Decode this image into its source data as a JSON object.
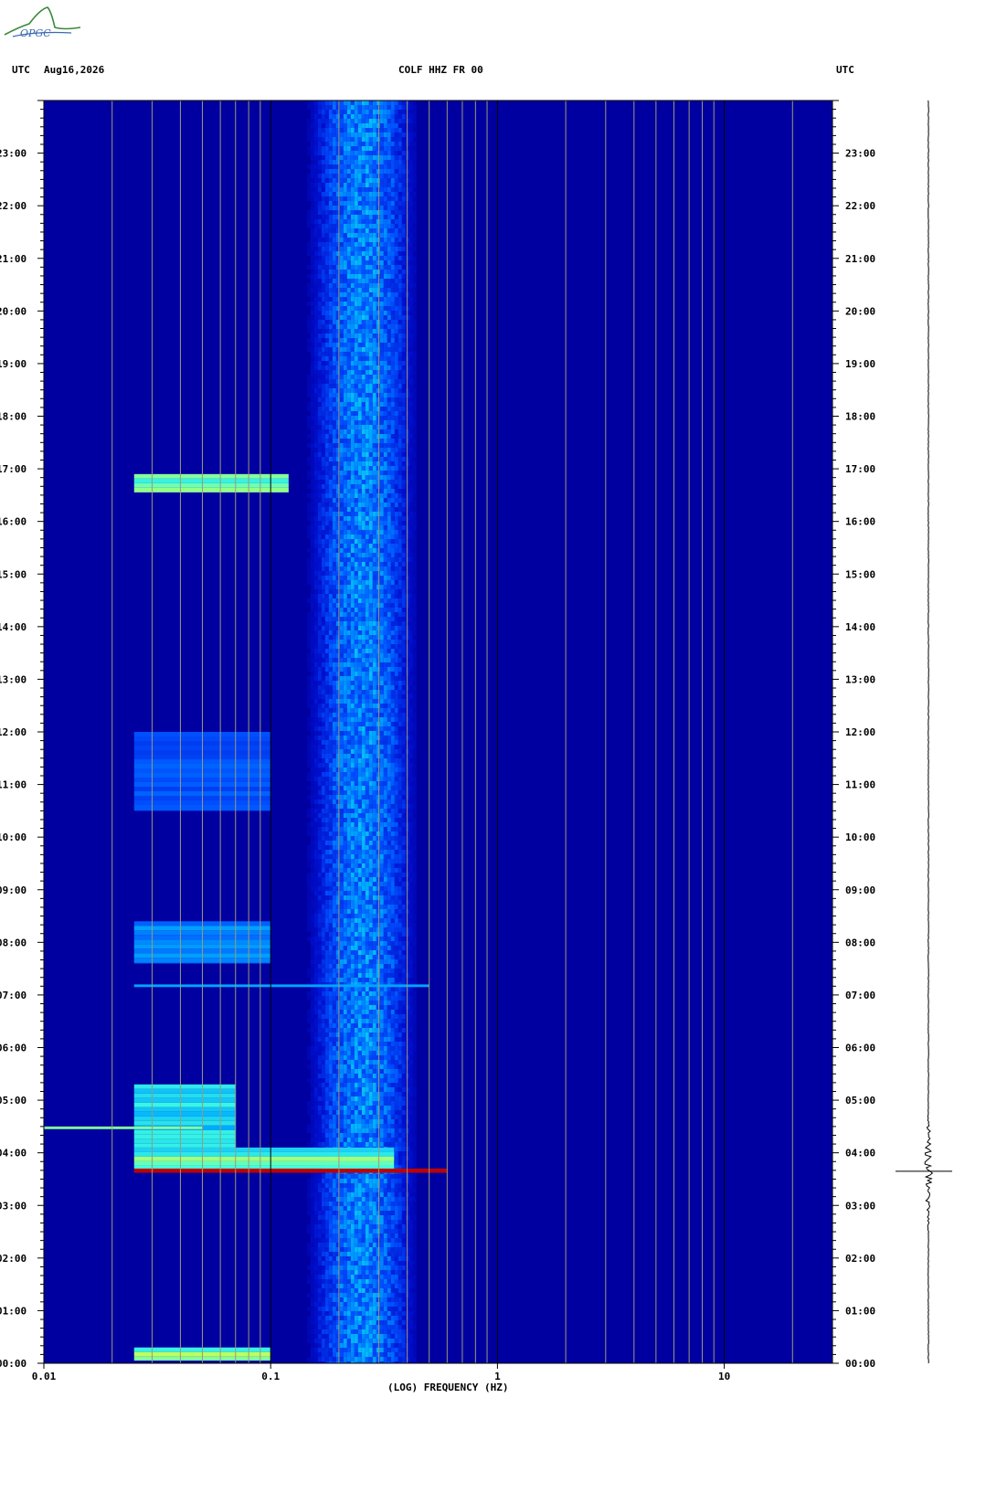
{
  "header": {
    "left_tz": "UTC",
    "date": "Aug16,2026",
    "station": "COLF HHZ FR 00",
    "right_tz": "UTC"
  },
  "logo": {
    "text": "OPGC",
    "color": "#3a8a3a"
  },
  "chart_data": {
    "type": "heatmap",
    "title": "COLF HHZ FR 00",
    "xlabel": "(LOG) FREQUENCY (HZ)",
    "x_scale": "log",
    "xlim": [
      0.01,
      30
    ],
    "x_ticks": [
      {
        "value": 0.01,
        "label": "0.01"
      },
      {
        "value": 0.1,
        "label": "0.1"
      },
      {
        "value": 1,
        "label": "1"
      },
      {
        "value": 10,
        "label": "10"
      }
    ],
    "ylabel": "UTC",
    "ylim_hours": [
      0,
      24
    ],
    "y_ticks": [
      {
        "hour": 0,
        "label": "00:00"
      },
      {
        "hour": 1,
        "label": "01:00"
      },
      {
        "hour": 2,
        "label": "02:00"
      },
      {
        "hour": 3,
        "label": "03:00"
      },
      {
        "hour": 4,
        "label": "04:00"
      },
      {
        "hour": 5,
        "label": "05:00"
      },
      {
        "hour": 6,
        "label": "06:00"
      },
      {
        "hour": 7,
        "label": "07:00"
      },
      {
        "hour": 8,
        "label": "08:00"
      },
      {
        "hour": 9,
        "label": "09:00"
      },
      {
        "hour": 10,
        "label": "10:00"
      },
      {
        "hour": 11,
        "label": "11:00"
      },
      {
        "hour": 12,
        "label": "12:00"
      },
      {
        "hour": 13,
        "label": "13:00"
      },
      {
        "hour": 14,
        "label": "14:00"
      },
      {
        "hour": 15,
        "label": "15:00"
      },
      {
        "hour": 16,
        "label": "16:00"
      },
      {
        "hour": 17,
        "label": "17:00"
      },
      {
        "hour": 18,
        "label": "18:00"
      },
      {
        "hour": 19,
        "label": "19:00"
      },
      {
        "hour": 20,
        "label": "20:00"
      },
      {
        "hour": 21,
        "label": "21:00"
      },
      {
        "hour": 22,
        "label": "22:00"
      },
      {
        "hour": 23,
        "label": "23:00"
      }
    ],
    "grid": true,
    "colormap": [
      "#0000a0",
      "#0010d0",
      "#0050ff",
      "#00b0ff",
      "#40ffe0",
      "#ffff20",
      "#c00000"
    ],
    "background_level": 0,
    "microseism_band": {
      "f_low": 0.12,
      "f_high": 0.45,
      "f_peak": 0.25,
      "level": 0.45
    },
    "events": [
      {
        "hour_start": 3.62,
        "hour_end": 3.7,
        "f_low": 0.025,
        "f_high": 0.6,
        "level": 1.0
      },
      {
        "hour_start": 3.7,
        "hour_end": 4.1,
        "f_low": 0.025,
        "f_high": 0.35,
        "level": 0.7
      },
      {
        "hour_start": 4.1,
        "hour_end": 5.3,
        "f_low": 0.025,
        "f_high": 0.07,
        "level": 0.6
      },
      {
        "hour_start": 4.45,
        "hour_end": 4.5,
        "f_low": 0.01,
        "f_high": 0.05,
        "level": 0.75
      },
      {
        "hour_start": 0.05,
        "hour_end": 0.3,
        "f_low": 0.025,
        "f_high": 0.1,
        "level": 0.8
      },
      {
        "hour_start": 7.15,
        "hour_end": 7.2,
        "f_low": 0.025,
        "f_high": 0.5,
        "level": 0.55
      },
      {
        "hour_start": 7.6,
        "hour_end": 8.4,
        "f_low": 0.025,
        "f_high": 0.1,
        "level": 0.45
      },
      {
        "hour_start": 10.5,
        "hour_end": 12.0,
        "f_low": 0.025,
        "f_high": 0.1,
        "level": 0.35
      },
      {
        "hour_start": 16.55,
        "hour_end": 16.9,
        "f_low": 0.025,
        "f_high": 0.12,
        "level": 0.7
      }
    ],
    "seismogram": {
      "event_hour": 3.65,
      "amplitude": "large"
    }
  }
}
